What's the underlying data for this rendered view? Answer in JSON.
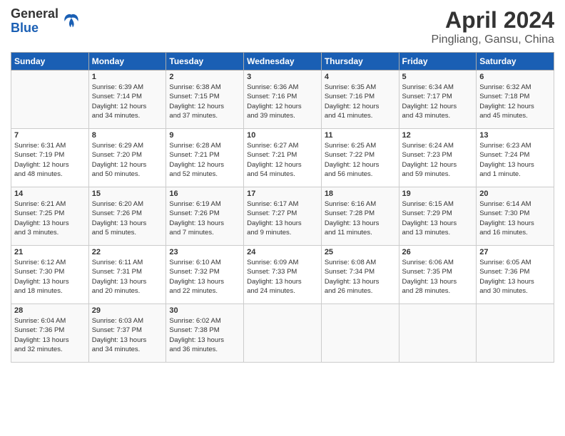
{
  "header": {
    "logo_general": "General",
    "logo_blue": "Blue",
    "month_title": "April 2024",
    "location": "Pingliang, Gansu, China"
  },
  "days_of_week": [
    "Sunday",
    "Monday",
    "Tuesday",
    "Wednesday",
    "Thursday",
    "Friday",
    "Saturday"
  ],
  "weeks": [
    [
      {
        "day": "",
        "info": ""
      },
      {
        "day": "1",
        "info": "Sunrise: 6:39 AM\nSunset: 7:14 PM\nDaylight: 12 hours\nand 34 minutes."
      },
      {
        "day": "2",
        "info": "Sunrise: 6:38 AM\nSunset: 7:15 PM\nDaylight: 12 hours\nand 37 minutes."
      },
      {
        "day": "3",
        "info": "Sunrise: 6:36 AM\nSunset: 7:16 PM\nDaylight: 12 hours\nand 39 minutes."
      },
      {
        "day": "4",
        "info": "Sunrise: 6:35 AM\nSunset: 7:16 PM\nDaylight: 12 hours\nand 41 minutes."
      },
      {
        "day": "5",
        "info": "Sunrise: 6:34 AM\nSunset: 7:17 PM\nDaylight: 12 hours\nand 43 minutes."
      },
      {
        "day": "6",
        "info": "Sunrise: 6:32 AM\nSunset: 7:18 PM\nDaylight: 12 hours\nand 45 minutes."
      }
    ],
    [
      {
        "day": "7",
        "info": "Sunrise: 6:31 AM\nSunset: 7:19 PM\nDaylight: 12 hours\nand 48 minutes."
      },
      {
        "day": "8",
        "info": "Sunrise: 6:29 AM\nSunset: 7:20 PM\nDaylight: 12 hours\nand 50 minutes."
      },
      {
        "day": "9",
        "info": "Sunrise: 6:28 AM\nSunset: 7:21 PM\nDaylight: 12 hours\nand 52 minutes."
      },
      {
        "day": "10",
        "info": "Sunrise: 6:27 AM\nSunset: 7:21 PM\nDaylight: 12 hours\nand 54 minutes."
      },
      {
        "day": "11",
        "info": "Sunrise: 6:25 AM\nSunset: 7:22 PM\nDaylight: 12 hours\nand 56 minutes."
      },
      {
        "day": "12",
        "info": "Sunrise: 6:24 AM\nSunset: 7:23 PM\nDaylight: 12 hours\nand 59 minutes."
      },
      {
        "day": "13",
        "info": "Sunrise: 6:23 AM\nSunset: 7:24 PM\nDaylight: 13 hours\nand 1 minute."
      }
    ],
    [
      {
        "day": "14",
        "info": "Sunrise: 6:21 AM\nSunset: 7:25 PM\nDaylight: 13 hours\nand 3 minutes."
      },
      {
        "day": "15",
        "info": "Sunrise: 6:20 AM\nSunset: 7:26 PM\nDaylight: 13 hours\nand 5 minutes."
      },
      {
        "day": "16",
        "info": "Sunrise: 6:19 AM\nSunset: 7:26 PM\nDaylight: 13 hours\nand 7 minutes."
      },
      {
        "day": "17",
        "info": "Sunrise: 6:17 AM\nSunset: 7:27 PM\nDaylight: 13 hours\nand 9 minutes."
      },
      {
        "day": "18",
        "info": "Sunrise: 6:16 AM\nSunset: 7:28 PM\nDaylight: 13 hours\nand 11 minutes."
      },
      {
        "day": "19",
        "info": "Sunrise: 6:15 AM\nSunset: 7:29 PM\nDaylight: 13 hours\nand 13 minutes."
      },
      {
        "day": "20",
        "info": "Sunrise: 6:14 AM\nSunset: 7:30 PM\nDaylight: 13 hours\nand 16 minutes."
      }
    ],
    [
      {
        "day": "21",
        "info": "Sunrise: 6:12 AM\nSunset: 7:30 PM\nDaylight: 13 hours\nand 18 minutes."
      },
      {
        "day": "22",
        "info": "Sunrise: 6:11 AM\nSunset: 7:31 PM\nDaylight: 13 hours\nand 20 minutes."
      },
      {
        "day": "23",
        "info": "Sunrise: 6:10 AM\nSunset: 7:32 PM\nDaylight: 13 hours\nand 22 minutes."
      },
      {
        "day": "24",
        "info": "Sunrise: 6:09 AM\nSunset: 7:33 PM\nDaylight: 13 hours\nand 24 minutes."
      },
      {
        "day": "25",
        "info": "Sunrise: 6:08 AM\nSunset: 7:34 PM\nDaylight: 13 hours\nand 26 minutes."
      },
      {
        "day": "26",
        "info": "Sunrise: 6:06 AM\nSunset: 7:35 PM\nDaylight: 13 hours\nand 28 minutes."
      },
      {
        "day": "27",
        "info": "Sunrise: 6:05 AM\nSunset: 7:36 PM\nDaylight: 13 hours\nand 30 minutes."
      }
    ],
    [
      {
        "day": "28",
        "info": "Sunrise: 6:04 AM\nSunset: 7:36 PM\nDaylight: 13 hours\nand 32 minutes."
      },
      {
        "day": "29",
        "info": "Sunrise: 6:03 AM\nSunset: 7:37 PM\nDaylight: 13 hours\nand 34 minutes."
      },
      {
        "day": "30",
        "info": "Sunrise: 6:02 AM\nSunset: 7:38 PM\nDaylight: 13 hours\nand 36 minutes."
      },
      {
        "day": "",
        "info": ""
      },
      {
        "day": "",
        "info": ""
      },
      {
        "day": "",
        "info": ""
      },
      {
        "day": "",
        "info": ""
      }
    ]
  ]
}
